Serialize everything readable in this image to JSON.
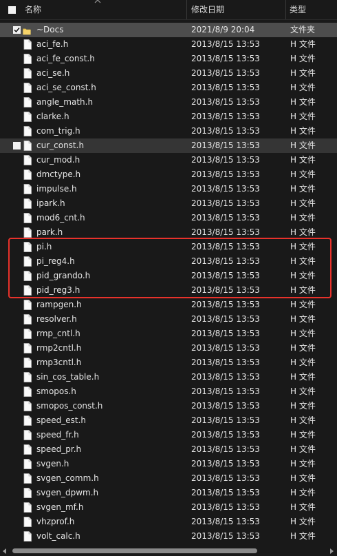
{
  "header": {
    "name_label": "名称",
    "date_label": "修改日期",
    "type_label": "类型"
  },
  "rows": [
    {
      "name": "~Docs",
      "date": "2021/8/9 20:04",
      "type": "文件夹",
      "kind": "folder",
      "state": "selected",
      "checkbox": "checked"
    },
    {
      "name": "aci_fe.h",
      "date": "2013/8/15 13:53",
      "type": "H 文件",
      "kind": "file"
    },
    {
      "name": "aci_fe_const.h",
      "date": "2013/8/15 13:53",
      "type": "H 文件",
      "kind": "file"
    },
    {
      "name": "aci_se.h",
      "date": "2013/8/15 13:53",
      "type": "H 文件",
      "kind": "file"
    },
    {
      "name": "aci_se_const.h",
      "date": "2013/8/15 13:53",
      "type": "H 文件",
      "kind": "file"
    },
    {
      "name": "angle_math.h",
      "date": "2013/8/15 13:53",
      "type": "H 文件",
      "kind": "file"
    },
    {
      "name": "clarke.h",
      "date": "2013/8/15 13:53",
      "type": "H 文件",
      "kind": "file"
    },
    {
      "name": "com_trig.h",
      "date": "2013/8/15 13:53",
      "type": "H 文件",
      "kind": "file"
    },
    {
      "name": "cur_const.h",
      "date": "2013/8/15 13:53",
      "type": "H 文件",
      "kind": "file",
      "state": "hover",
      "checkbox": "unchecked"
    },
    {
      "name": "cur_mod.h",
      "date": "2013/8/15 13:53",
      "type": "H 文件",
      "kind": "file"
    },
    {
      "name": "dmctype.h",
      "date": "2013/8/15 13:53",
      "type": "H 文件",
      "kind": "file"
    },
    {
      "name": "impulse.h",
      "date": "2013/8/15 13:53",
      "type": "H 文件",
      "kind": "file"
    },
    {
      "name": "ipark.h",
      "date": "2013/8/15 13:53",
      "type": "H 文件",
      "kind": "file"
    },
    {
      "name": "mod6_cnt.h",
      "date": "2013/8/15 13:53",
      "type": "H 文件",
      "kind": "file"
    },
    {
      "name": "park.h",
      "date": "2013/8/15 13:53",
      "type": "H 文件",
      "kind": "file"
    },
    {
      "name": "pi.h",
      "date": "2013/8/15 13:53",
      "type": "H 文件",
      "kind": "file"
    },
    {
      "name": "pi_reg4.h",
      "date": "2013/8/15 13:53",
      "type": "H 文件",
      "kind": "file"
    },
    {
      "name": "pid_grando.h",
      "date": "2013/8/15 13:53",
      "type": "H 文件",
      "kind": "file"
    },
    {
      "name": "pid_reg3.h",
      "date": "2013/8/15 13:53",
      "type": "H 文件",
      "kind": "file"
    },
    {
      "name": "rampgen.h",
      "date": "2013/8/15 13:53",
      "type": "H 文件",
      "kind": "file"
    },
    {
      "name": "resolver.h",
      "date": "2013/8/15 13:53",
      "type": "H 文件",
      "kind": "file"
    },
    {
      "name": "rmp_cntl.h",
      "date": "2013/8/15 13:53",
      "type": "H 文件",
      "kind": "file"
    },
    {
      "name": "rmp2cntl.h",
      "date": "2013/8/15 13:53",
      "type": "H 文件",
      "kind": "file"
    },
    {
      "name": "rmp3cntl.h",
      "date": "2013/8/15 13:53",
      "type": "H 文件",
      "kind": "file"
    },
    {
      "name": "sin_cos_table.h",
      "date": "2013/8/15 13:53",
      "type": "H 文件",
      "kind": "file"
    },
    {
      "name": "smopos.h",
      "date": "2013/8/15 13:53",
      "type": "H 文件",
      "kind": "file"
    },
    {
      "name": "smopos_const.h",
      "date": "2013/8/15 13:53",
      "type": "H 文件",
      "kind": "file"
    },
    {
      "name": "speed_est.h",
      "date": "2013/8/15 13:53",
      "type": "H 文件",
      "kind": "file"
    },
    {
      "name": "speed_fr.h",
      "date": "2013/8/15 13:53",
      "type": "H 文件",
      "kind": "file"
    },
    {
      "name": "speed_pr.h",
      "date": "2013/8/15 13:53",
      "type": "H 文件",
      "kind": "file"
    },
    {
      "name": "svgen.h",
      "date": "2013/8/15 13:53",
      "type": "H 文件",
      "kind": "file"
    },
    {
      "name": "svgen_comm.h",
      "date": "2013/8/15 13:53",
      "type": "H 文件",
      "kind": "file"
    },
    {
      "name": "svgen_dpwm.h",
      "date": "2013/8/15 13:53",
      "type": "H 文件",
      "kind": "file"
    },
    {
      "name": "svgen_mf.h",
      "date": "2013/8/15 13:53",
      "type": "H 文件",
      "kind": "file"
    },
    {
      "name": "vhzprof.h",
      "date": "2013/8/15 13:53",
      "type": "H 文件",
      "kind": "file"
    },
    {
      "name": "volt_calc.h",
      "date": "2013/8/15 13:53",
      "type": "H 文件",
      "kind": "file"
    }
  ],
  "highlight_color": "#e8322b",
  "folder_color": "#e8c24a",
  "icons": {
    "select_all": "checkbox-icon",
    "sort": "chevron-up-icon",
    "folder": "folder-icon",
    "file": "file-icon",
    "scroll_left": "chevron-left-icon",
    "scroll_right": "chevron-right-icon"
  }
}
